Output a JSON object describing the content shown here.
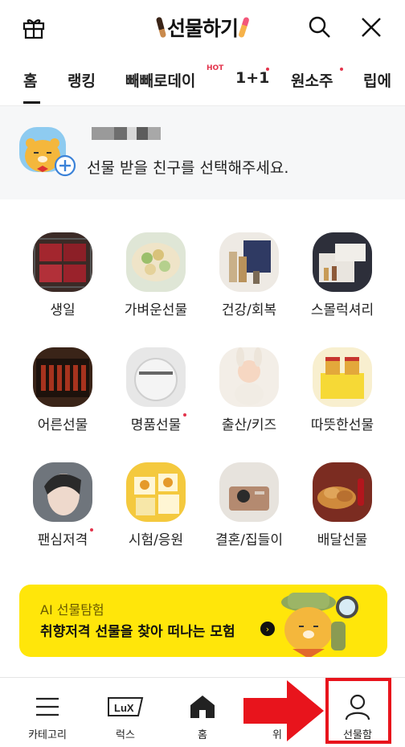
{
  "header": {
    "title": "선물하기",
    "icons": [
      "gift-icon",
      "search-icon",
      "close-icon"
    ]
  },
  "tabs": [
    {
      "label": "홈",
      "active": true
    },
    {
      "label": "랭킹"
    },
    {
      "label": "빼빼로데이",
      "badge": "HOT"
    },
    {
      "label": "1+1",
      "dot": true
    },
    {
      "label": "원소주",
      "dot": true
    },
    {
      "label": "립에"
    }
  ],
  "friend_banner": {
    "text": "선물 받을 친구를 선택해주세요."
  },
  "categories": [
    {
      "label": "생일"
    },
    {
      "label": "가벼운선물"
    },
    {
      "label": "건강/회복"
    },
    {
      "label": "스몰럭셔리"
    },
    {
      "label": "어른선물"
    },
    {
      "label": "명품선물",
      "dot": true
    },
    {
      "label": "출산/키즈"
    },
    {
      "label": "따뜻한선물"
    },
    {
      "label": "팬심저격",
      "dot": true
    },
    {
      "label": "시험/응원"
    },
    {
      "label": "결혼/집들이"
    },
    {
      "label": "배달선물"
    }
  ],
  "ai_banner": {
    "subtitle": "AI 선물탐험",
    "title": "취향저격 선물을 찾아 떠나는 모험"
  },
  "bottom_nav": [
    {
      "label": "카테고리",
      "icon": "menu-icon"
    },
    {
      "label": "럭스",
      "icon": "lux-icon"
    },
    {
      "label": "홈",
      "icon": "home-icon"
    },
    {
      "label": "위",
      "icon": "wish-icon"
    },
    {
      "label": "선물함",
      "icon": "user-icon"
    }
  ],
  "colors": {
    "accent_yellow": "#ffe60a",
    "alert_red": "#e8141c",
    "dot_red": "#e3344c"
  }
}
